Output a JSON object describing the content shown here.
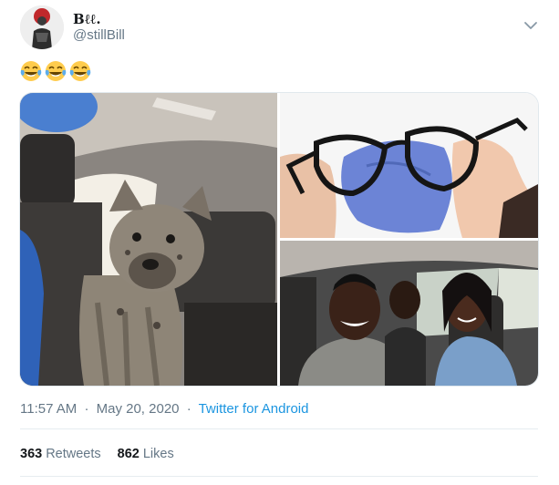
{
  "author": {
    "display_name": "Bℓℓ.",
    "handle": "@stillBill"
  },
  "tweet": {
    "emoji_text": "😂😂😂",
    "emoji_count": 3
  },
  "media": [
    {
      "subject": "hyena in car back seat"
    },
    {
      "subject": "hands cleaning glasses"
    },
    {
      "subject": "three people in car"
    }
  ],
  "meta": {
    "time": "11:57 AM",
    "separator": "·",
    "date": "May 20, 2020",
    "source": "Twitter for Android"
  },
  "stats": {
    "retweets_count": "363",
    "retweets_label": "Retweets",
    "likes_count": "862",
    "likes_label": "Likes"
  },
  "colors": {
    "link": "#1b95e0",
    "secondary_text": "#657786",
    "divider": "#e6ecf0"
  },
  "icons": {
    "menu": "chevron-down-icon",
    "emoji": "laughing-crying-emoji"
  }
}
